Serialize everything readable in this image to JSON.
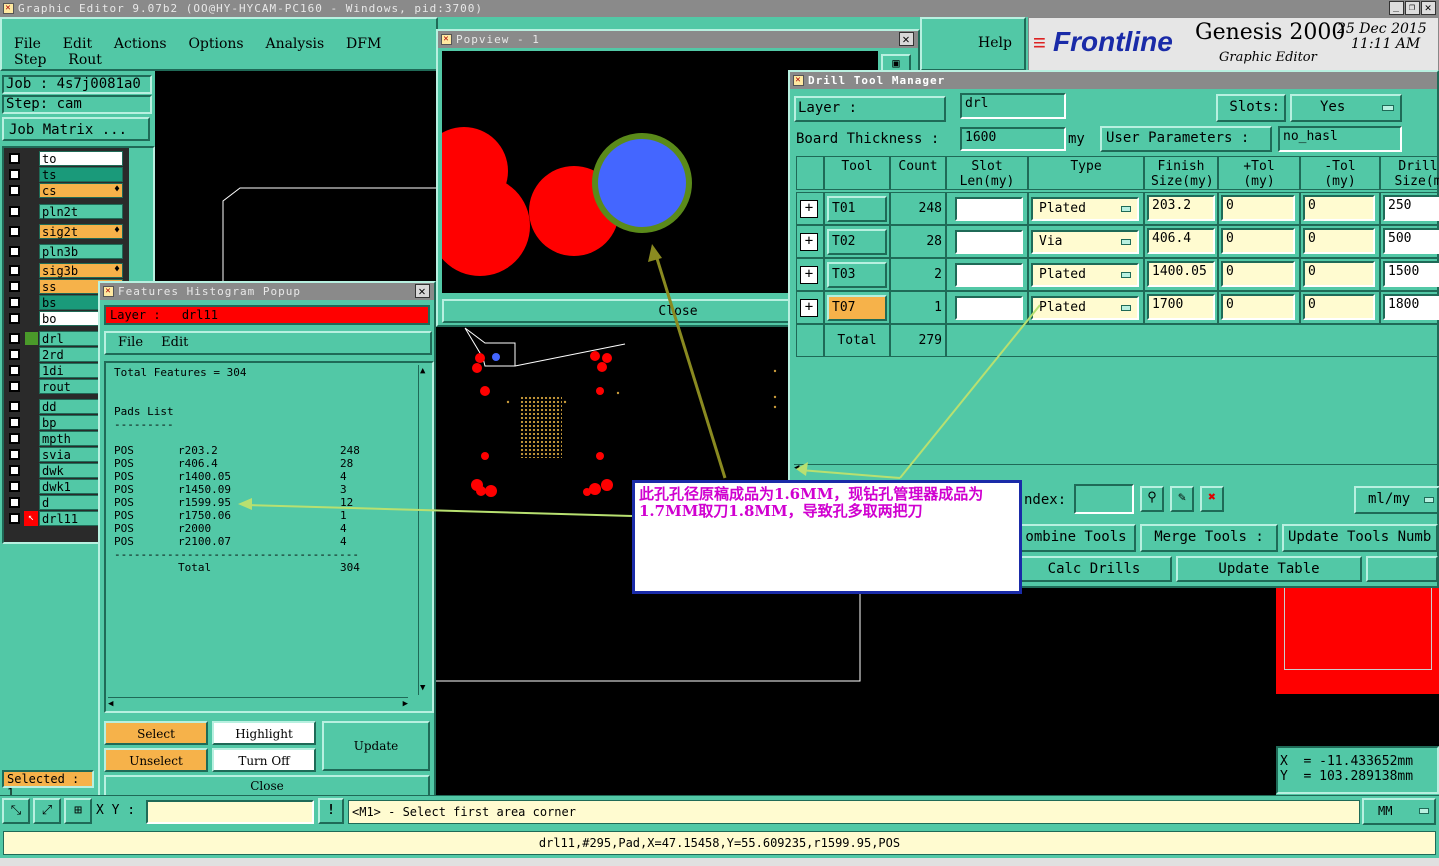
{
  "window": {
    "title": "Graphic Editor 9.07b2 (OO@HY-HYCAM-PC160 - Windows, pid:3700)"
  },
  "menu": [
    "File",
    "Edit",
    "Actions",
    "Options",
    "Analysis",
    "DFM",
    "Step",
    "Rout"
  ],
  "help_label": "Help",
  "brand": {
    "logo": "Frontline",
    "product": "Genesis 2000",
    "subtitle": "Graphic Editor",
    "date": "25 Dec 2015",
    "time": "11:11 AM"
  },
  "job": {
    "job_label": "Job : 4s7j0081a0",
    "step_label": "Step: cam",
    "matrix_button": "Job Matrix ..."
  },
  "layers": [
    {
      "name": "to",
      "color": "#ffffff"
    },
    {
      "name": "ts",
      "color": "#1a9a7a"
    },
    {
      "name": "cs",
      "color": "#f6b24a"
    },
    {
      "name": "pln2t",
      "color": "#52c8a6"
    },
    {
      "name": "sig2t",
      "color": "#f6b24a"
    },
    {
      "name": "pln3b",
      "color": "#52c8a6"
    },
    {
      "name": "sig3b",
      "color": "#f6b24a"
    },
    {
      "name": "ss",
      "color": "#f6b24a"
    },
    {
      "name": "bs",
      "color": "#1a9a7a"
    },
    {
      "name": "bo",
      "color": "#ffffff"
    },
    {
      "name": "drl",
      "color": "#52c8a6"
    },
    {
      "name": "2rd",
      "color": "#52c8a6"
    },
    {
      "name": "1di",
      "color": "#52c8a6"
    },
    {
      "name": "rout",
      "color": "#52c8a6"
    },
    {
      "name": "dd",
      "color": "#52c8a6"
    },
    {
      "name": "bp",
      "color": "#52c8a6"
    },
    {
      "name": "mpth",
      "color": "#52c8a6"
    },
    {
      "name": "svia",
      "color": "#52c8a6"
    },
    {
      "name": "dwk",
      "color": "#52c8a6"
    },
    {
      "name": "dwk1",
      "color": "#52c8a6"
    },
    {
      "name": "d",
      "color": "#52c8a6"
    },
    {
      "name": "drl11",
      "color": "#52c8a6"
    }
  ],
  "selected_label": "Selected : 1",
  "popview": {
    "title": "Popview - 1",
    "close": "Close"
  },
  "histogram": {
    "title": "Features Histogram Popup",
    "layer_label": "Layer :",
    "layer_value": "drl11",
    "menu": [
      "File",
      "Edit"
    ],
    "total_features": "Total Features = 304",
    "section": "Pads List",
    "underline": "---------",
    "rows": [
      {
        "type": "POS",
        "size": "r203.2",
        "count": "248"
      },
      {
        "type": "POS",
        "size": "r406.4",
        "count": "28"
      },
      {
        "type": "POS",
        "size": "r1400.05",
        "count": "4"
      },
      {
        "type": "POS",
        "size": "r1450.09",
        "count": "3"
      },
      {
        "type": "POS",
        "size": "r1599.95",
        "count": "12"
      },
      {
        "type": "POS",
        "size": "r1750.06",
        "count": "1"
      },
      {
        "type": "POS",
        "size": "r2000",
        "count": "4"
      },
      {
        "type": "POS",
        "size": "r2100.07",
        "count": "4"
      }
    ],
    "divider": "-------------------------------------",
    "total_label": "Total",
    "total_value": "304",
    "buttons": {
      "select": "Select",
      "highlight": "Highlight",
      "update": "Update",
      "unselect": "Unselect",
      "turn_off": "Turn Off",
      "close": "Close"
    }
  },
  "drill": {
    "title": "Drill Tool Manager",
    "layer_label": "Layer :",
    "layer_value": "drl",
    "slots_label": "Slots:",
    "slots_value": "Yes",
    "thickness_label": "Board Thickness :",
    "thickness_value": "1600",
    "thickness_unit": "my",
    "user_params_label": "User Parameters :",
    "user_params_value": "no_hasl",
    "headers": [
      "Tool",
      "Count",
      "Slot Len(my)",
      "Type",
      "Finish Size(my)",
      "+Tol (my)",
      "-Tol (my)",
      "Drill Size(m"
    ],
    "rows": [
      {
        "tool": "T01",
        "count": "248",
        "type": "Plated",
        "finish": "203.2",
        "ptol": "0",
        "ntol": "0",
        "drill": "250"
      },
      {
        "tool": "T02",
        "count": "28",
        "type": "Via",
        "finish": "406.4",
        "ptol": "0",
        "ntol": "0",
        "drill": "500"
      },
      {
        "tool": "T03",
        "count": "2",
        "type": "Plated",
        "finish": "1400.05",
        "ptol": "0",
        "ntol": "0",
        "drill": "1500"
      },
      {
        "tool": "T07",
        "count": "1",
        "type": "Plated",
        "finish": "1700",
        "ptol": "0",
        "ntol": "0",
        "drill": "1800"
      }
    ],
    "total_label": "Total",
    "total_value": "279",
    "index_label": "ndex:",
    "units_value": "ml/my",
    "buttons": {
      "combine": "ombine Tools",
      "merge": "Merge Tools :",
      "update_numbers": "Update Tools Numb",
      "calc": "Calc Drills",
      "update_table": "Update Table"
    }
  },
  "annotation": "此孔孔径原稿成品为1.6MM，现钻孔管理器成品为1.7MM取刀1.8MM，导致孔多取两把刀",
  "coords": {
    "x": "X  = -11.433652mm",
    "y": "Y  = 103.289138mm"
  },
  "bottom": {
    "xy_label": "X Y :",
    "prompt": "<M1> - Select first area corner",
    "units": "MM",
    "status": "drl11,#295,Pad,X=47.15458,Y=55.609235,r1599.95,POS"
  },
  "colors": {
    "teal": "#52c8a6",
    "orange": "#f6b24a",
    "red": "#ff0000",
    "blue": "#4466ff",
    "annotation_text": "#d000d0"
  }
}
